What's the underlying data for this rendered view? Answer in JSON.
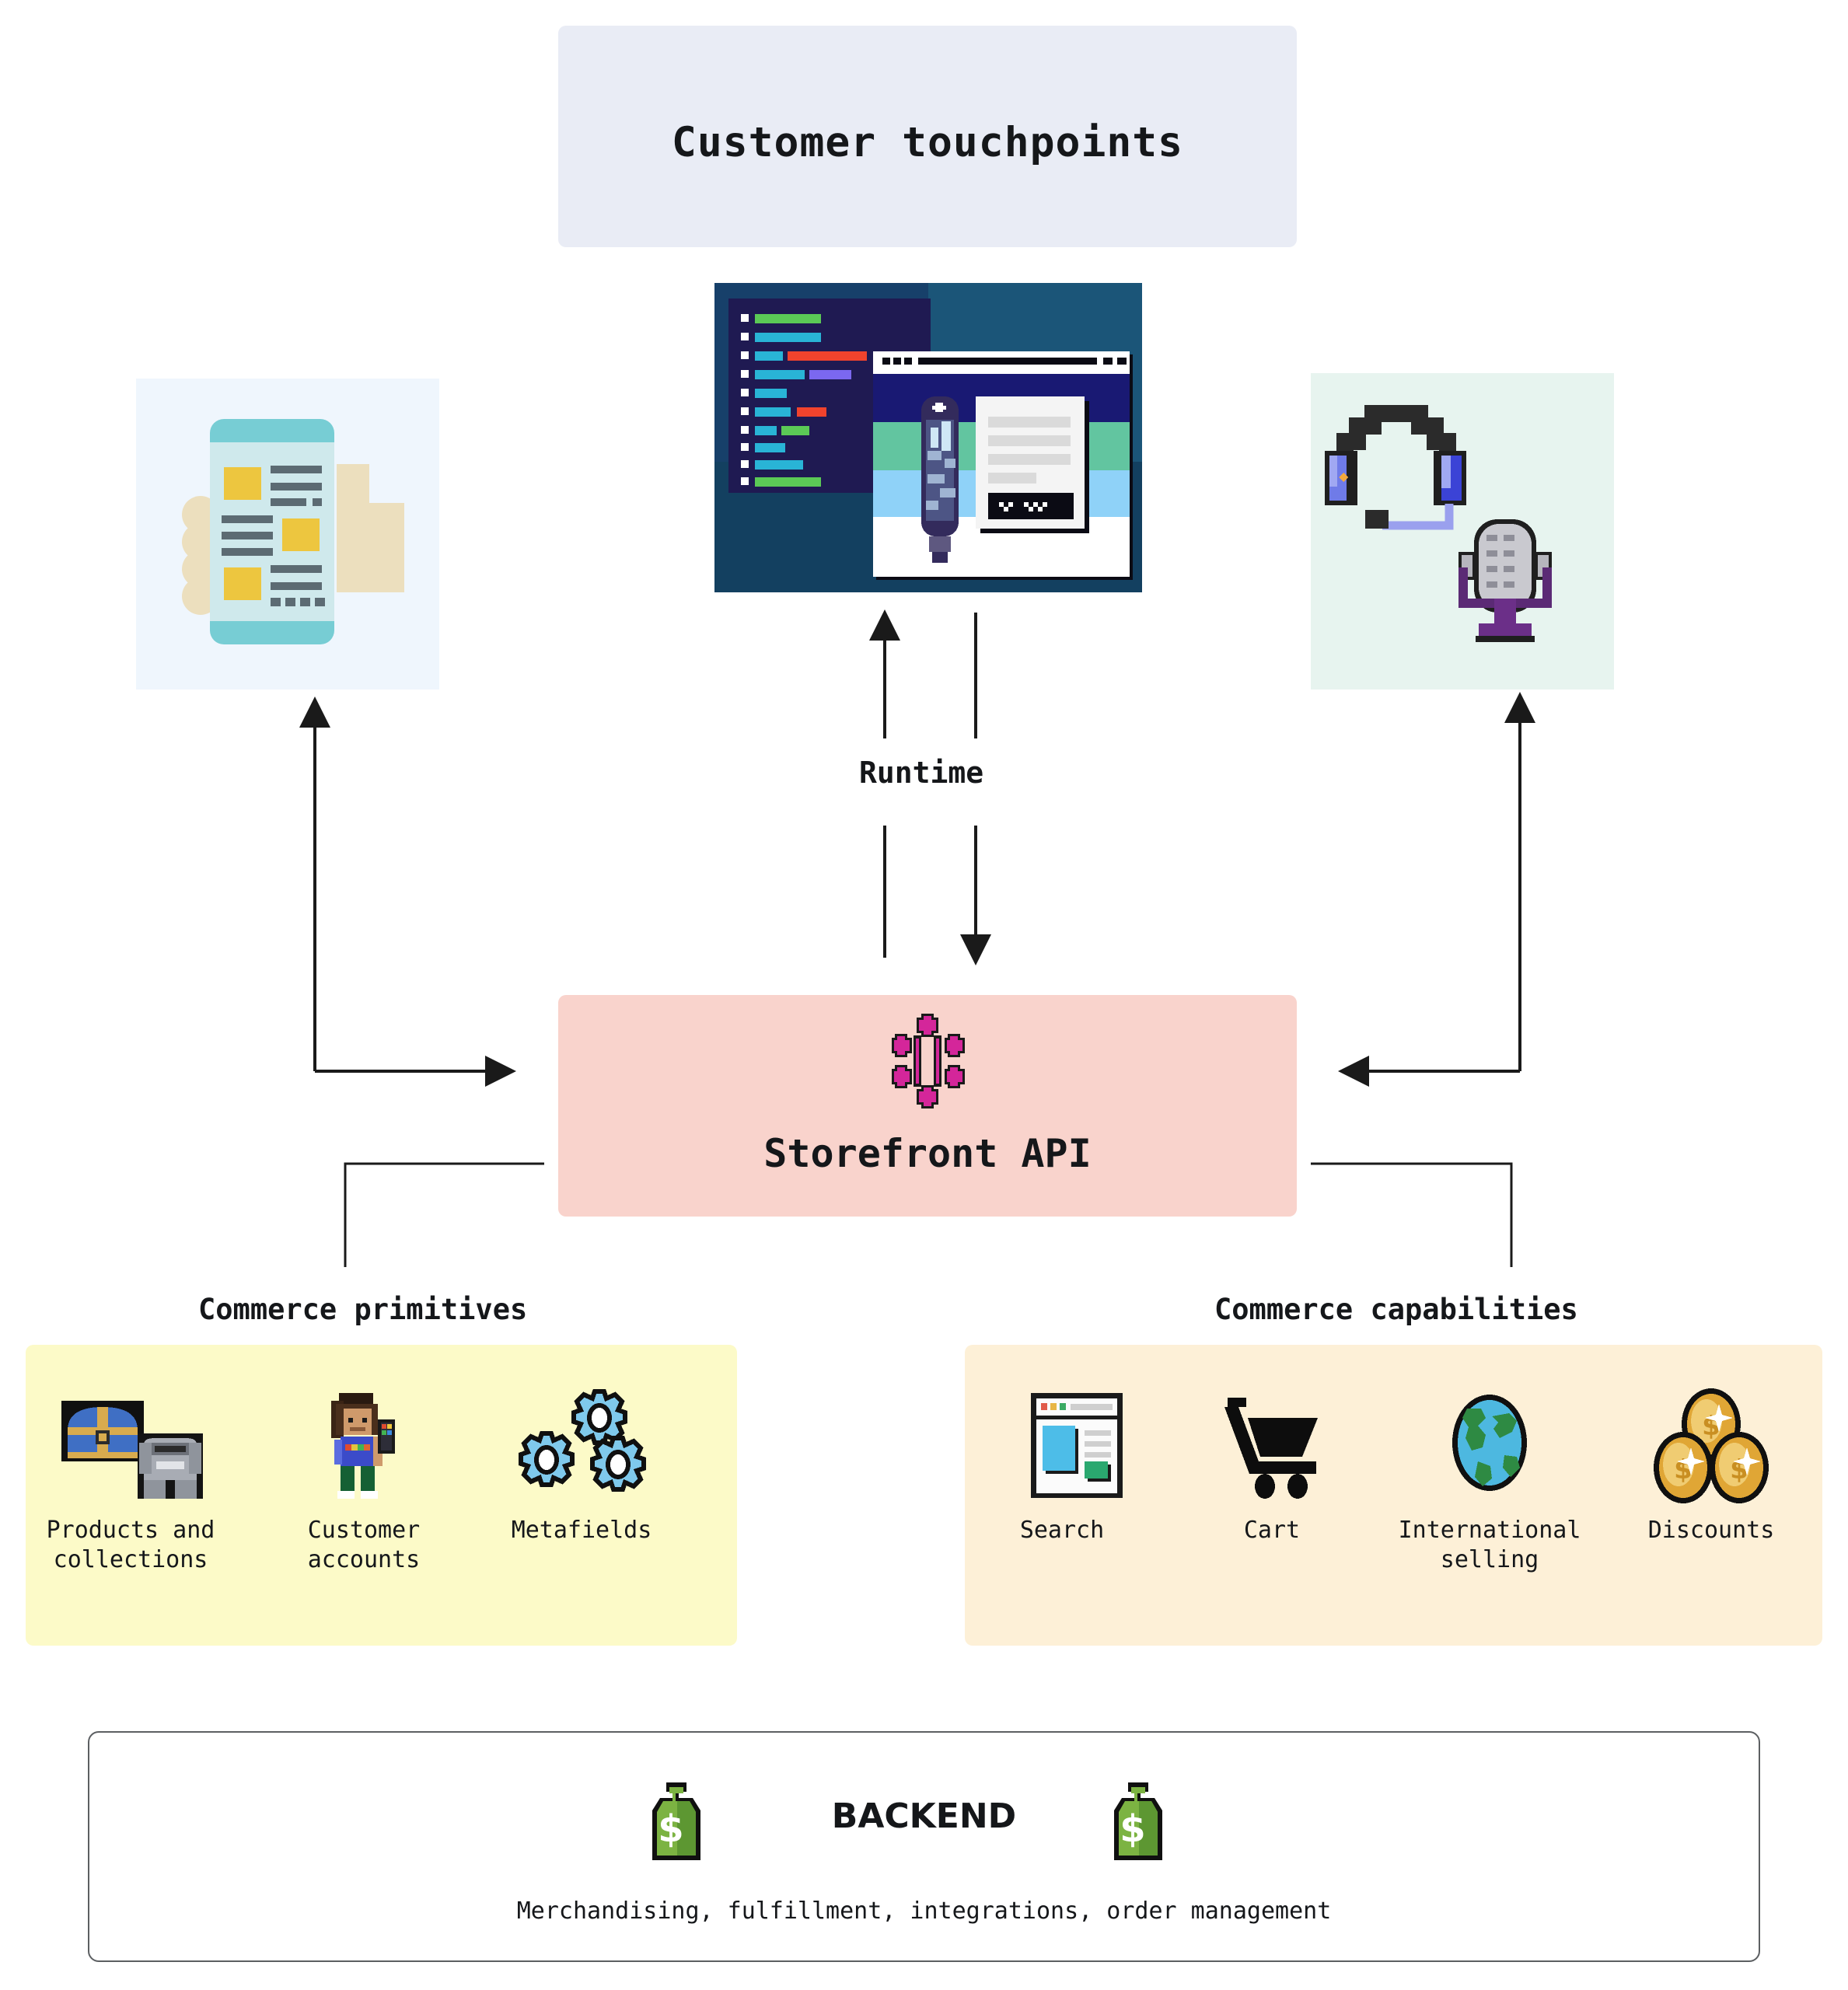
{
  "header": {
    "title": "Customer touchpoints"
  },
  "center": {
    "illustration_name": "code-editor-and-browser-illustration"
  },
  "touchpoint_panels": [
    {
      "id": "mobile",
      "icon": "mobile-phone-in-hand-icon",
      "bg": "#eff6fd"
    },
    {
      "id": "voice",
      "icon": "headset-and-microphone-icon",
      "bg": "#e7f4ef"
    }
  ],
  "runtime": {
    "label": "Runtime"
  },
  "storefront": {
    "label": "Storefront API",
    "icon": "graphql-node-graph-icon",
    "color": "#f9d3cc"
  },
  "sections": {
    "primitives": {
      "caption": "Commerce primitives",
      "color": "#fcfac8",
      "items": [
        {
          "label": "Products and\ncollections",
          "line1": "Products and",
          "line2": "collections",
          "icon": "treasure-chest-and-armor-icon"
        },
        {
          "label": "Customer\naccounts",
          "line1": "Customer",
          "line2": "accounts",
          "icon": "customer-character-icon"
        },
        {
          "label": "Metafields",
          "line1": "Metafields",
          "line2": "",
          "icon": "gears-icon"
        }
      ]
    },
    "capabilities": {
      "caption": "Commerce capabilities",
      "color": "#fdf0d7",
      "items": [
        {
          "label": "Search",
          "line1": "Search",
          "line2": "",
          "icon": "browser-window-icon"
        },
        {
          "label": "Cart",
          "line1": "Cart",
          "line2": "",
          "icon": "shopping-cart-icon"
        },
        {
          "label": "International\nselling",
          "line1": "International",
          "line2": "selling",
          "icon": "globe-icon"
        },
        {
          "label": "Discounts",
          "line1": "Discounts",
          "line2": "",
          "icon": "gold-coins-icon"
        }
      ]
    }
  },
  "backend": {
    "title": "BACKEND",
    "subtitle": "Merchandising, fulfillment, integrations, order management",
    "icon": "money-bag-icon"
  },
  "colors": {
    "header_bg": "#e9ecf5",
    "storefront_bg": "#f9d3cc",
    "primitives_bg": "#fcfac8",
    "capabilities_bg": "#fdf0d7",
    "mobile_bg": "#eff6fd",
    "voice_bg": "#e7f4ef",
    "line": "#1a1a1a"
  }
}
